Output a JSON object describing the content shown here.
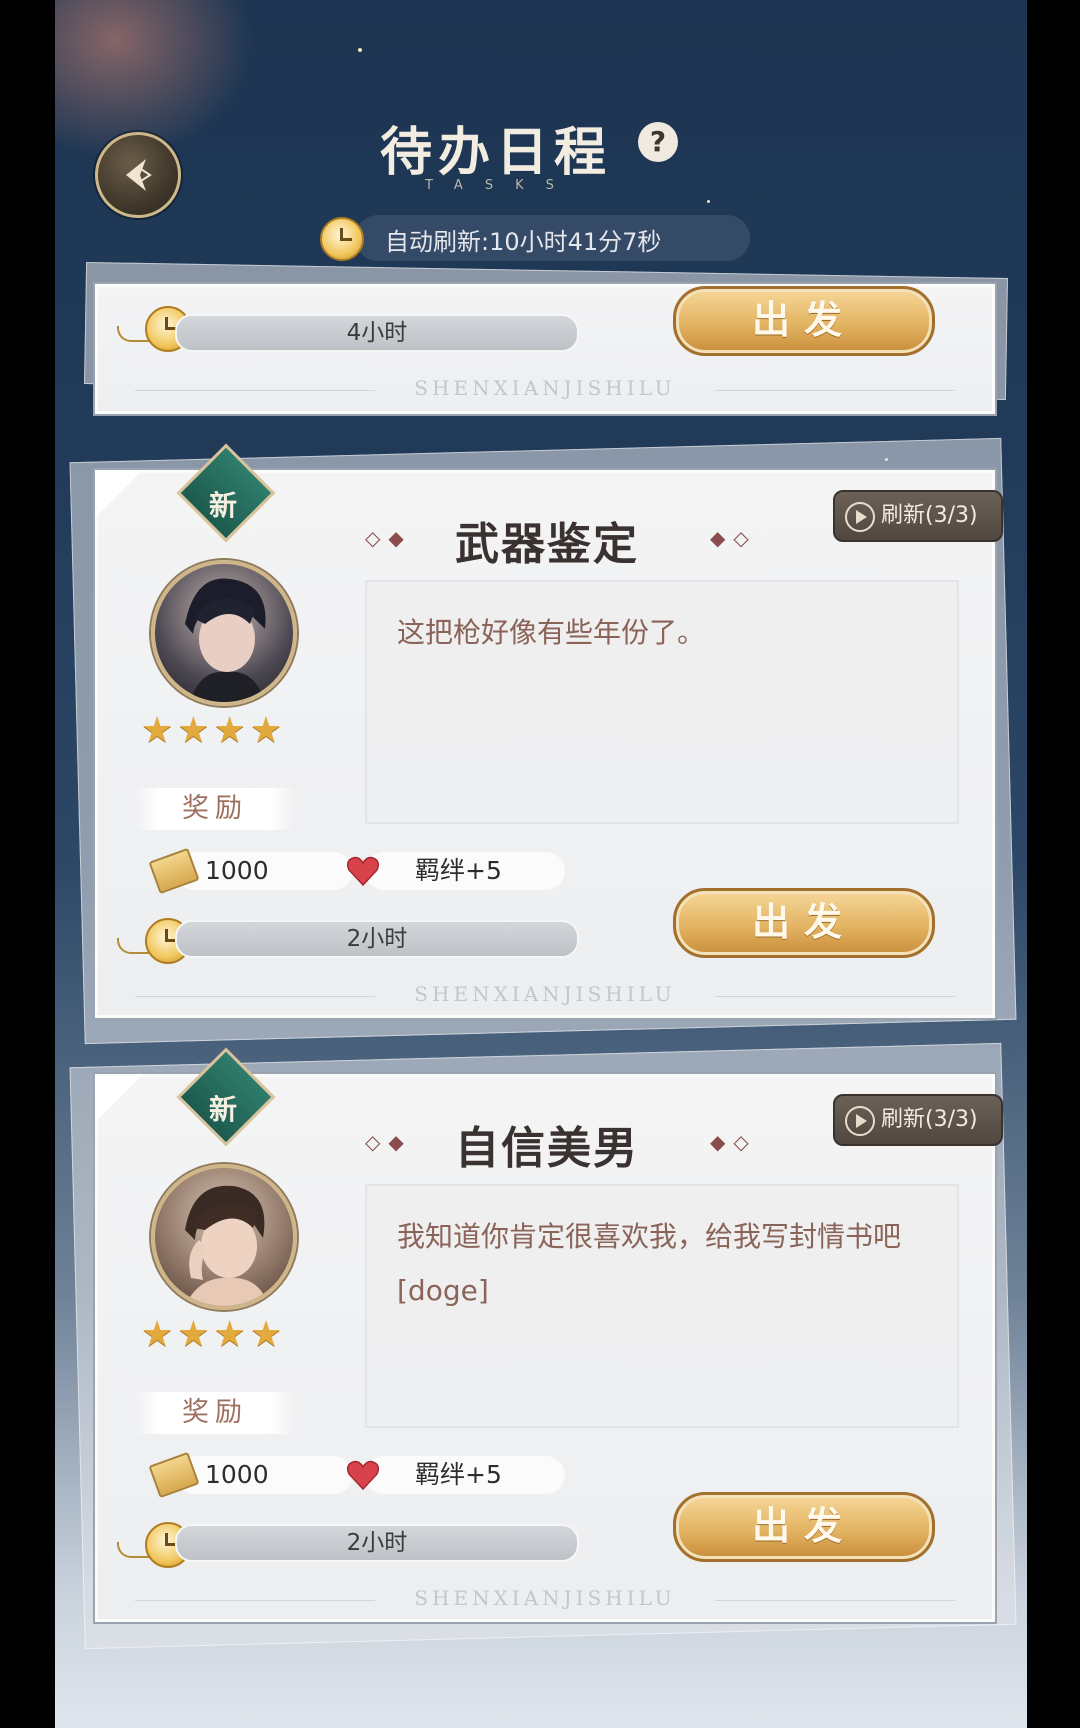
{
  "header": {
    "title": "待办日程",
    "subtitle": "TASKS",
    "help_glyph": "?",
    "refresh_text": "自动刷新:10小时41分7秒"
  },
  "cards": [
    {
      "duration": "4小时",
      "go_label": "出发",
      "brand": "SHENXIANJISHILU"
    },
    {
      "new_label": "新",
      "title": "武器鉴定",
      "refresh_label": "刷新(3/3)",
      "description": "这把枪好像有些年份了。",
      "stars": "★★★★",
      "reward_label": "奖励",
      "reward_amount": "1000",
      "bond": "羁绊+5",
      "duration": "2小时",
      "go_label": "出发",
      "brand": "SHENXIANJISHILU"
    },
    {
      "new_label": "新",
      "title": "自信美男",
      "refresh_label": "刷新(3/3)",
      "description": "我知道你肯定很喜欢我，给我写封情书吧[doge]",
      "stars": "★★★★",
      "reward_label": "奖励",
      "reward_amount": "1000",
      "bond": "羁绊+5",
      "duration": "2小时",
      "go_label": "出发",
      "brand": "SHENXIANJISHILU"
    }
  ],
  "icons": [
    "back-arrow-icon",
    "help-icon",
    "pocket-watch-icon",
    "play-icon",
    "ticket-icon",
    "heart-icon",
    "star-icon"
  ],
  "colors": {
    "accent_gold": "#e3b463",
    "new_tag_green": "#2f7d6c",
    "title_text": "#3a3230"
  }
}
